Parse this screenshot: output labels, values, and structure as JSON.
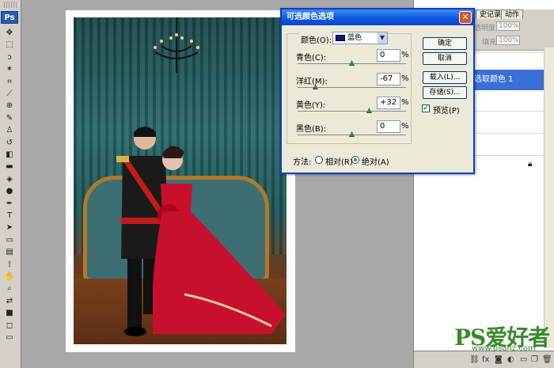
{
  "toolbox": {
    "logo": "Ps",
    "tools": [
      {
        "name": "move-tool-icon",
        "glyph": "✥"
      },
      {
        "name": "marquee-tool-icon",
        "glyph": "⬚"
      },
      {
        "name": "lasso-tool-icon",
        "glyph": "ↄ"
      },
      {
        "name": "magic-wand-tool-icon",
        "glyph": "✶"
      },
      {
        "name": "crop-tool-icon",
        "glyph": "⌗"
      },
      {
        "name": "slice-tool-icon",
        "glyph": "⟋"
      },
      {
        "name": "healing-brush-tool-icon",
        "glyph": "⊕"
      },
      {
        "name": "brush-tool-icon",
        "glyph": "✎"
      },
      {
        "name": "clone-stamp-tool-icon",
        "glyph": "♙"
      },
      {
        "name": "history-brush-tool-icon",
        "glyph": "↺"
      },
      {
        "name": "eraser-tool-icon",
        "glyph": "◧"
      },
      {
        "name": "gradient-tool-icon",
        "glyph": "▬"
      },
      {
        "name": "blur-tool-icon",
        "glyph": "◈"
      },
      {
        "name": "dodge-tool-icon",
        "glyph": "●"
      },
      {
        "name": "pen-tool-icon",
        "glyph": "✒"
      },
      {
        "name": "type-tool-icon",
        "glyph": "T"
      },
      {
        "name": "path-selection-tool-icon",
        "glyph": "➤"
      },
      {
        "name": "shape-tool-icon",
        "glyph": "▭"
      },
      {
        "name": "notes-tool-icon",
        "glyph": "▤"
      },
      {
        "name": "eyedropper-tool-icon",
        "glyph": "⟟"
      },
      {
        "name": "hand-tool-icon",
        "glyph": "✋"
      },
      {
        "name": "zoom-tool-icon",
        "glyph": "⌕"
      },
      {
        "name": "color-swap-icon",
        "glyph": "⇄"
      },
      {
        "name": "color-swatches-icon",
        "glyph": "■"
      },
      {
        "name": "quick-mask-icon",
        "glyph": "◻"
      },
      {
        "name": "screen-mode-icon",
        "glyph": "▭"
      }
    ]
  },
  "history_panel": {
    "tabs": [
      "史记录",
      "动作"
    ],
    "opacity_label": "透明度:",
    "opacity_value": "100%",
    "fill_label": "填充:",
    "fill_value": "100%",
    "selected_item": "选取颜色 1",
    "bottom_icons": [
      "link-icon",
      "fx-icon",
      "mask-icon",
      "adjustment-icon",
      "folder-icon",
      "new-layer-icon",
      "trash-icon"
    ]
  },
  "dialog": {
    "title": "可选颜色选项",
    "close_glyph": "✕",
    "color_label": "颜色(O):",
    "color_value": "蓝色",
    "swatch_color": "#0a1a8a",
    "sliders": [
      {
        "label": "青色(C):",
        "value": "0",
        "unit": "%"
      },
      {
        "label": "洋红(M):",
        "value": "-67",
        "unit": "%"
      },
      {
        "label": "黄色(Y):",
        "value": "+32",
        "unit": "%"
      },
      {
        "label": "黑色(B):",
        "value": "0",
        "unit": "%"
      }
    ],
    "buttons": {
      "ok": "确定",
      "cancel": "取消",
      "load": "载入(L)...",
      "save": "存储(S)..."
    },
    "preview_label": "预览(P)",
    "preview_checked": true,
    "method_label": "方法:",
    "method_relative": "相对(R)",
    "method_absolute": "绝对(A)",
    "method_selected": "absolute"
  },
  "watermark": {
    "logo": "PS爱好者",
    "url": "www.psahz.com"
  }
}
